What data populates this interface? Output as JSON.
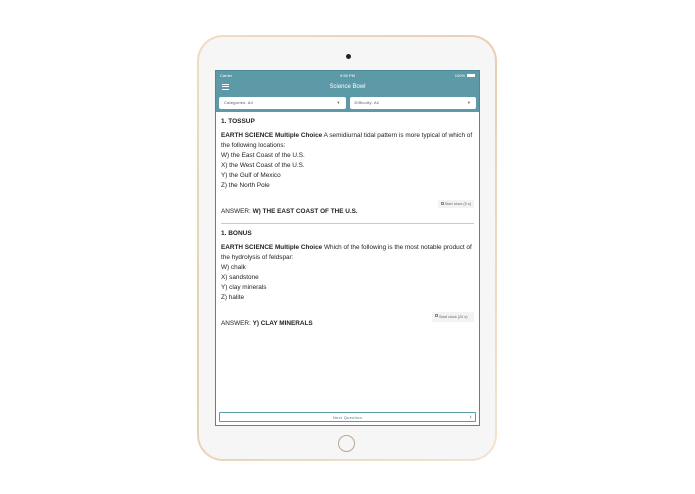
{
  "status_bar": {
    "carrier": "Carrier",
    "time": "9:56 PM",
    "battery": "100%"
  },
  "navbar": {
    "title": "Science Bowl"
  },
  "filters": {
    "category": "Categories: All",
    "difficulty": "Difficulty: All"
  },
  "tossup": {
    "title": "1. TOSSUP",
    "category": "EARTH SCIENCE Multiple Choice",
    "question": "A semidiurnal tidal pattern is more typical of which of the following locations:",
    "choices": [
      "W) the East Coast of the U.S.",
      "X) the West Coast of the U.S.",
      "Y) the Gulf of Mexico",
      "Z) the North Pole"
    ],
    "answer_label": "ANSWER:",
    "answer": "W) THE EAST COAST OF THE U.S.",
    "clock_label": "Start clock (5 s)"
  },
  "bonus": {
    "title": "1. BONUS",
    "category": "EARTH SCIENCE Multiple Choice",
    "question": "Which of the following is the most notable product of the hydrolysis of feldspar:",
    "choices": [
      "W) chalk",
      "X) sandstone",
      "Y) clay minerals",
      "Z) halite"
    ],
    "answer_label": "ANSWER:",
    "answer": "Y) CLAY MINERALS",
    "clock_label": "Start clock (20 s)"
  },
  "footer": {
    "next_label": "Next Question"
  },
  "colors": {
    "accent": "#5b9aa6",
    "device_gold": "#e9d3b8"
  }
}
